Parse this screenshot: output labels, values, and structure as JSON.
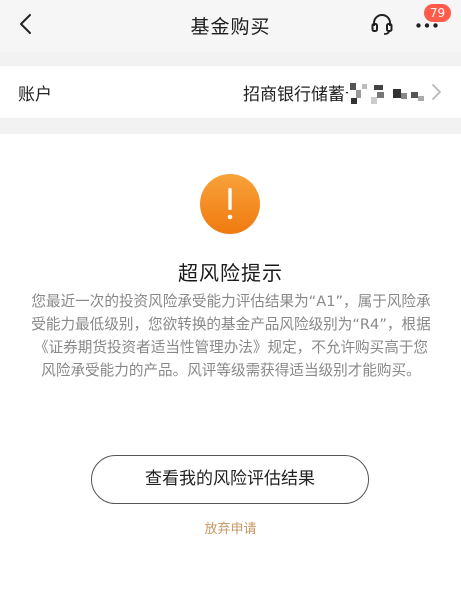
{
  "navbar": {
    "title": "基金购买",
    "badge_count": "79"
  },
  "account": {
    "label": "账户",
    "bank_name": "招商银行储蓄卡"
  },
  "warning": {
    "title": "超风险提示",
    "message": "您最近一次的投资风险承受能力评估结果为“A1”，属于风险承受能力最低级别，您欲转换的基金产品风险级别为“R4”，根据《证券期货投资者适当性管理办法》规定，不允许购买高于您风险承受能力的产品。风评等级需获得适当级别才能购买。"
  },
  "actions": {
    "view_result_label": "查看我的风险评估结果",
    "abandon_label": "放弃申请"
  },
  "colors": {
    "accent_orange": "#f28a1e",
    "badge_red": "#ff5a4a",
    "link_gold": "#c89560",
    "body_gray": "#888888"
  },
  "icons": [
    "chevron-left-icon",
    "headset-icon",
    "more-icon",
    "chevron-right-icon",
    "exclamation-icon"
  ]
}
